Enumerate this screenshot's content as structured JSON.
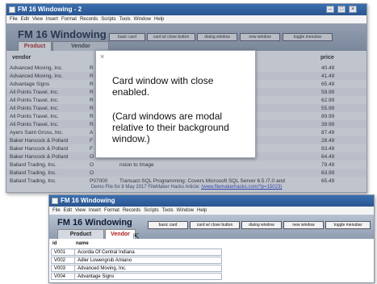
{
  "back_window": {
    "title": "FM 16 Windowing - 2",
    "menu": [
      "File",
      "Edit",
      "View",
      "Insert",
      "Format",
      "Records",
      "Scripts",
      "Tools",
      "Window",
      "Help"
    ],
    "app_title": "FM 16 Windowing",
    "buttons": [
      "basic card",
      "card w/ close button",
      "dialog window",
      "new window",
      "toggle menubar"
    ],
    "tabs": [
      "Product",
      "Vendor"
    ],
    "columns": {
      "vendor": "vendor",
      "price": "price"
    },
    "rows": [
      {
        "vendor": "Advanced Moving, Inc.",
        "id": "R",
        "desc": "",
        "price": "40.49"
      },
      {
        "vendor": "Advanced Moving, Inc.",
        "id": "R",
        "desc": "",
        "price": "41.49"
      },
      {
        "vendor": "Advantage Signs",
        "id": "R",
        "desc": "",
        "price": "65.49"
      },
      {
        "vendor": "All Points Travel, Inc.",
        "id": "R",
        "desc": "",
        "price": "59.99"
      },
      {
        "vendor": "All Points Travel, Inc.",
        "id": "R",
        "desc": "",
        "price": "62.99"
      },
      {
        "vendor": "All Points Travel, Inc.",
        "id": "R",
        "desc": "",
        "price": "55.99"
      },
      {
        "vendor": "All Points Travel, Inc.",
        "id": "R",
        "desc": "",
        "price": "89.99"
      },
      {
        "vendor": "All Points Travel, Inc.",
        "id": "R",
        "desc": "",
        "price": "39.99"
      },
      {
        "vendor": "Ayers Saint Gross, Inc.",
        "id": "A",
        "desc": "",
        "price": "87.49"
      },
      {
        "vendor": "Baker Hancock & Pollard",
        "id": "F",
        "desc": "",
        "price": "28.49"
      },
      {
        "vendor": "Baker Hancock & Pollard",
        "id": "F",
        "desc": "nd Edition",
        "price": "83.49"
      },
      {
        "vendor": "Baker Hancock & Pollard",
        "id": "O",
        "desc": "",
        "price": "64.49"
      },
      {
        "vendor": "Ballard Trading, Inc.",
        "id": "O",
        "desc": "nsion to Image",
        "price": "79.49"
      },
      {
        "vendor": "Ballard Trading, Inc.",
        "id": "O",
        "desc": "",
        "price": "63.99"
      },
      {
        "vendor": "Ballard Trading, Inc.",
        "id": "P07000",
        "desc": "Transact-SQL Programming: Covers Microsoft SQL Server 6.5 /7.0 and",
        "price": "65.49"
      }
    ],
    "footer_text": "Demo File for 8 May 2017 FileMaker Hacks Article:",
    "footer_link": "(www.filemakerhacks.com/?p=15023)"
  },
  "card_window": {
    "close_icon": "×",
    "line1": "Card window with close enabled.",
    "line2": "(Card windows are modal relative to their background window.)"
  },
  "front_window": {
    "title": "FM 16 Windowing",
    "menu": [
      "File",
      "Edit",
      "View",
      "Insert",
      "Format",
      "Records",
      "Scripts",
      "Tools",
      "Window",
      "Help"
    ],
    "app_title": "FM 16 Windowing",
    "buttons": [
      "basic card",
      "card w/ close button",
      "dialog window",
      "new window",
      "toggle menubar"
    ],
    "tabs": [
      "Product",
      "Vendor"
    ],
    "columns": {
      "id": "id",
      "name": "name"
    },
    "rows": [
      {
        "id": "V001",
        "name": "Acordia Of Central Indiana"
      },
      {
        "id": "V002",
        "name": "Adler Lowengrub Amiano"
      },
      {
        "id": "V003",
        "name": "Advanced Moving, Inc."
      },
      {
        "id": "V004",
        "name": "Advantage Signs"
      }
    ]
  },
  "colors": {
    "titlebar": "#2f62a4",
    "header": "#a3b0c1",
    "tab_active": "#b01818",
    "overlay": "#5a6478"
  }
}
